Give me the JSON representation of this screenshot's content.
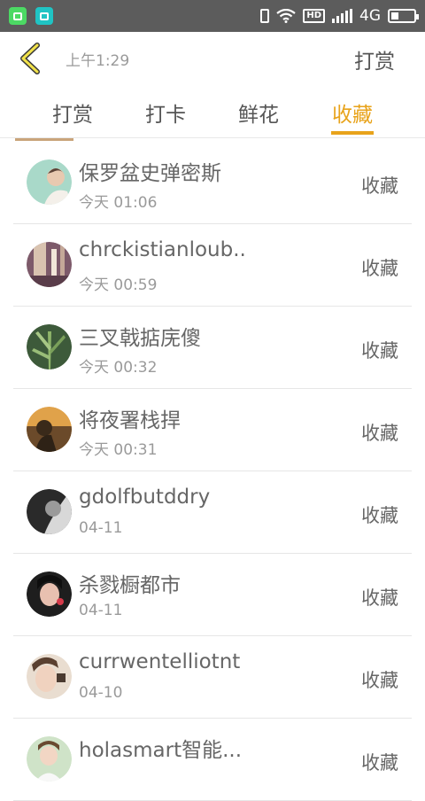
{
  "status_bar": {
    "time": "上午1:29",
    "network": "4G"
  },
  "header": {
    "action_label": "打赏"
  },
  "tabs": [
    {
      "label": "打赏",
      "active": false
    },
    {
      "label": "打卡",
      "active": false
    },
    {
      "label": "鲜花",
      "active": false
    },
    {
      "label": "收藏",
      "active": true
    }
  ],
  "colors": {
    "accent": "#e8a31b",
    "status_bar_bg": "#5c5c5c",
    "text": "#666666",
    "subtext": "#9a9a9a"
  },
  "list": [
    {
      "name": "保罗盆史弹密斯",
      "time": "今天 01:06",
      "action": "收藏",
      "avatar": "avatar-1"
    },
    {
      "name": "chrckistianloub...",
      "time": "今天 00:59",
      "action": "收藏",
      "avatar": "avatar-2"
    },
    {
      "name": "三叉戟掂庑傻",
      "time": "今天 00:32",
      "action": "收藏",
      "avatar": "avatar-3"
    },
    {
      "name": "将夜署栈捍",
      "time": "今天 00:31",
      "action": "收藏",
      "avatar": "avatar-4"
    },
    {
      "name": "gdolfbutddry",
      "time": "04-11",
      "action": "收藏",
      "avatar": "avatar-5"
    },
    {
      "name": "杀戮橱都市",
      "time": "04-11",
      "action": "收藏",
      "avatar": "avatar-6"
    },
    {
      "name": "currwentelliotnt",
      "time": "04-10",
      "action": "收藏",
      "avatar": "avatar-7"
    },
    {
      "name": "holasmart智能...",
      "time": "",
      "action": "收藏",
      "avatar": "avatar-8"
    }
  ]
}
